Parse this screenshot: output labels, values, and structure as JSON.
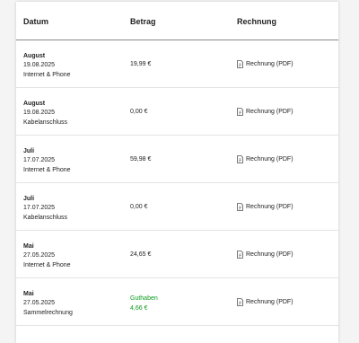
{
  "table": {
    "headers": {
      "date": "Datum",
      "amount": "Betrag",
      "invoice": "Rechnung"
    },
    "rows": [
      {
        "month": "August",
        "date": "19.08.2025",
        "type": "Internet & Phone",
        "amount": "19,99 €",
        "invoice": "Rechnung (PDF)"
      },
      {
        "month": "August",
        "date": "19.08.2025",
        "type": "Kabelanschluss",
        "amount": "0,00 €",
        "invoice": "Rechnung (PDF)"
      },
      {
        "month": "Juli",
        "date": "17.07.2025",
        "type": "Internet & Phone",
        "amount": "59,98 €",
        "invoice": "Rechnung (PDF)"
      },
      {
        "month": "Juli",
        "date": "17.07.2025",
        "type": "Kabelanschluss",
        "amount": "0,00 €",
        "invoice": "Rechnung (PDF)"
      },
      {
        "month": "Mai",
        "date": "27.05.2025",
        "type": "Internet & Phone",
        "amount": "24,65 €",
        "invoice": "Rechnung (PDF)"
      },
      {
        "month": "Mai",
        "date": "27.05.2025",
        "type": "Sammelrechnung",
        "amount_label": "Guthaben",
        "amount": "4,66 €",
        "invoice": "Rechnung (PDF)"
      }
    ]
  },
  "colors": {
    "credit": "#0a9a1d",
    "divider": "#888888"
  },
  "icons": {
    "invoice": "document-icon"
  }
}
